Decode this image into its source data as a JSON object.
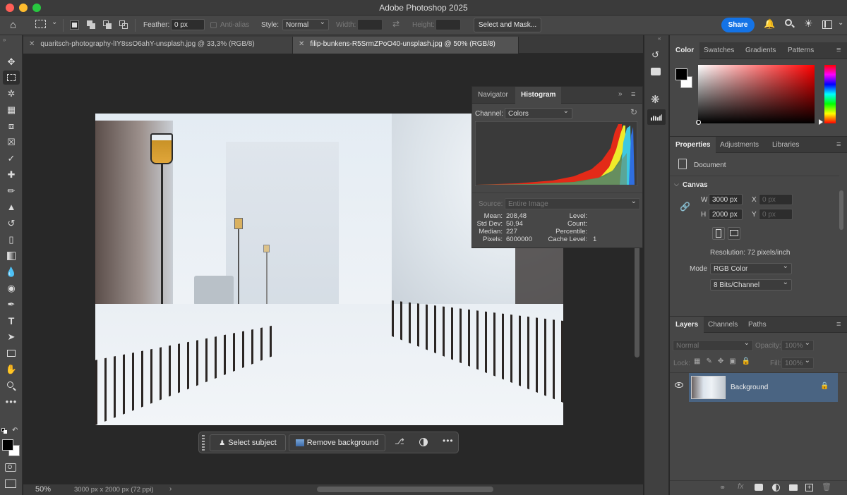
{
  "app": {
    "title": "Adobe Photoshop 2025"
  },
  "options": {
    "feather_label": "Feather:",
    "feather_value": "0 px",
    "antialias_label": "Anti-alias",
    "style_label": "Style:",
    "style_value": "Normal",
    "width_label": "Width:",
    "height_label": "Height:",
    "select_mask_label": "Select and Mask...",
    "share_label": "Share"
  },
  "tabs": [
    {
      "label": "quaritsch-photography-lIY8ssO6ahY-unsplash.jpg @ 33,3% (RGB/8)"
    },
    {
      "label": "filip-bunkens-R5SrmZPoO40-unsplash.jpg @ 50% (RGB/8)"
    }
  ],
  "status": {
    "zoom": "50%",
    "doc_info": "3000 px x 2000 px (72 ppi)"
  },
  "taskbar": {
    "select_subject": "Select subject",
    "remove_background": "Remove background"
  },
  "histogram": {
    "tab_navigator": "Navigator",
    "tab_histogram": "Histogram",
    "channel_label": "Channel:",
    "channel_value": "Colors",
    "source_label": "Source:",
    "source_value": "Entire Image",
    "mean_label": "Mean:",
    "mean": "208,48",
    "std_label": "Std Dev:",
    "std": "50,94",
    "median_label": "Median:",
    "median": "227",
    "pixels_label": "Pixels:",
    "pixels": "6000000",
    "level_label": "Level:",
    "count_label": "Count:",
    "percentile_label": "Percentile:",
    "cache_label": "Cache Level:",
    "cache": "1"
  },
  "color_panel": {
    "tabs": [
      "Color",
      "Swatches",
      "Gradients",
      "Patterns"
    ]
  },
  "properties": {
    "tabs": [
      "Properties",
      "Adjustments",
      "Libraries"
    ],
    "document_label": "Document",
    "canvas_label": "Canvas",
    "w_label": "W",
    "w_value": "3000 px",
    "h_label": "H",
    "h_value": "2000 px",
    "x_label": "X",
    "x_placeholder": "0 px",
    "y_label": "Y",
    "y_placeholder": "0 px",
    "resolution": "Resolution: 72 pixels/inch",
    "mode_label": "Mode",
    "mode_value": "RGB Color",
    "bits_value": "8 Bits/Channel"
  },
  "layers": {
    "tabs": [
      "Layers",
      "Channels",
      "Paths"
    ],
    "blend_value": "Normal",
    "opacity_label": "Opacity:",
    "opacity_value": "100%",
    "lock_label": "Lock:",
    "fill_label": "Fill:",
    "fill_value": "100%",
    "layer_name": "Background"
  },
  "colors": {
    "accent": "#1473e6",
    "layer_selected": "#4a6482",
    "fg": "#000000",
    "bg": "#ffffff"
  }
}
